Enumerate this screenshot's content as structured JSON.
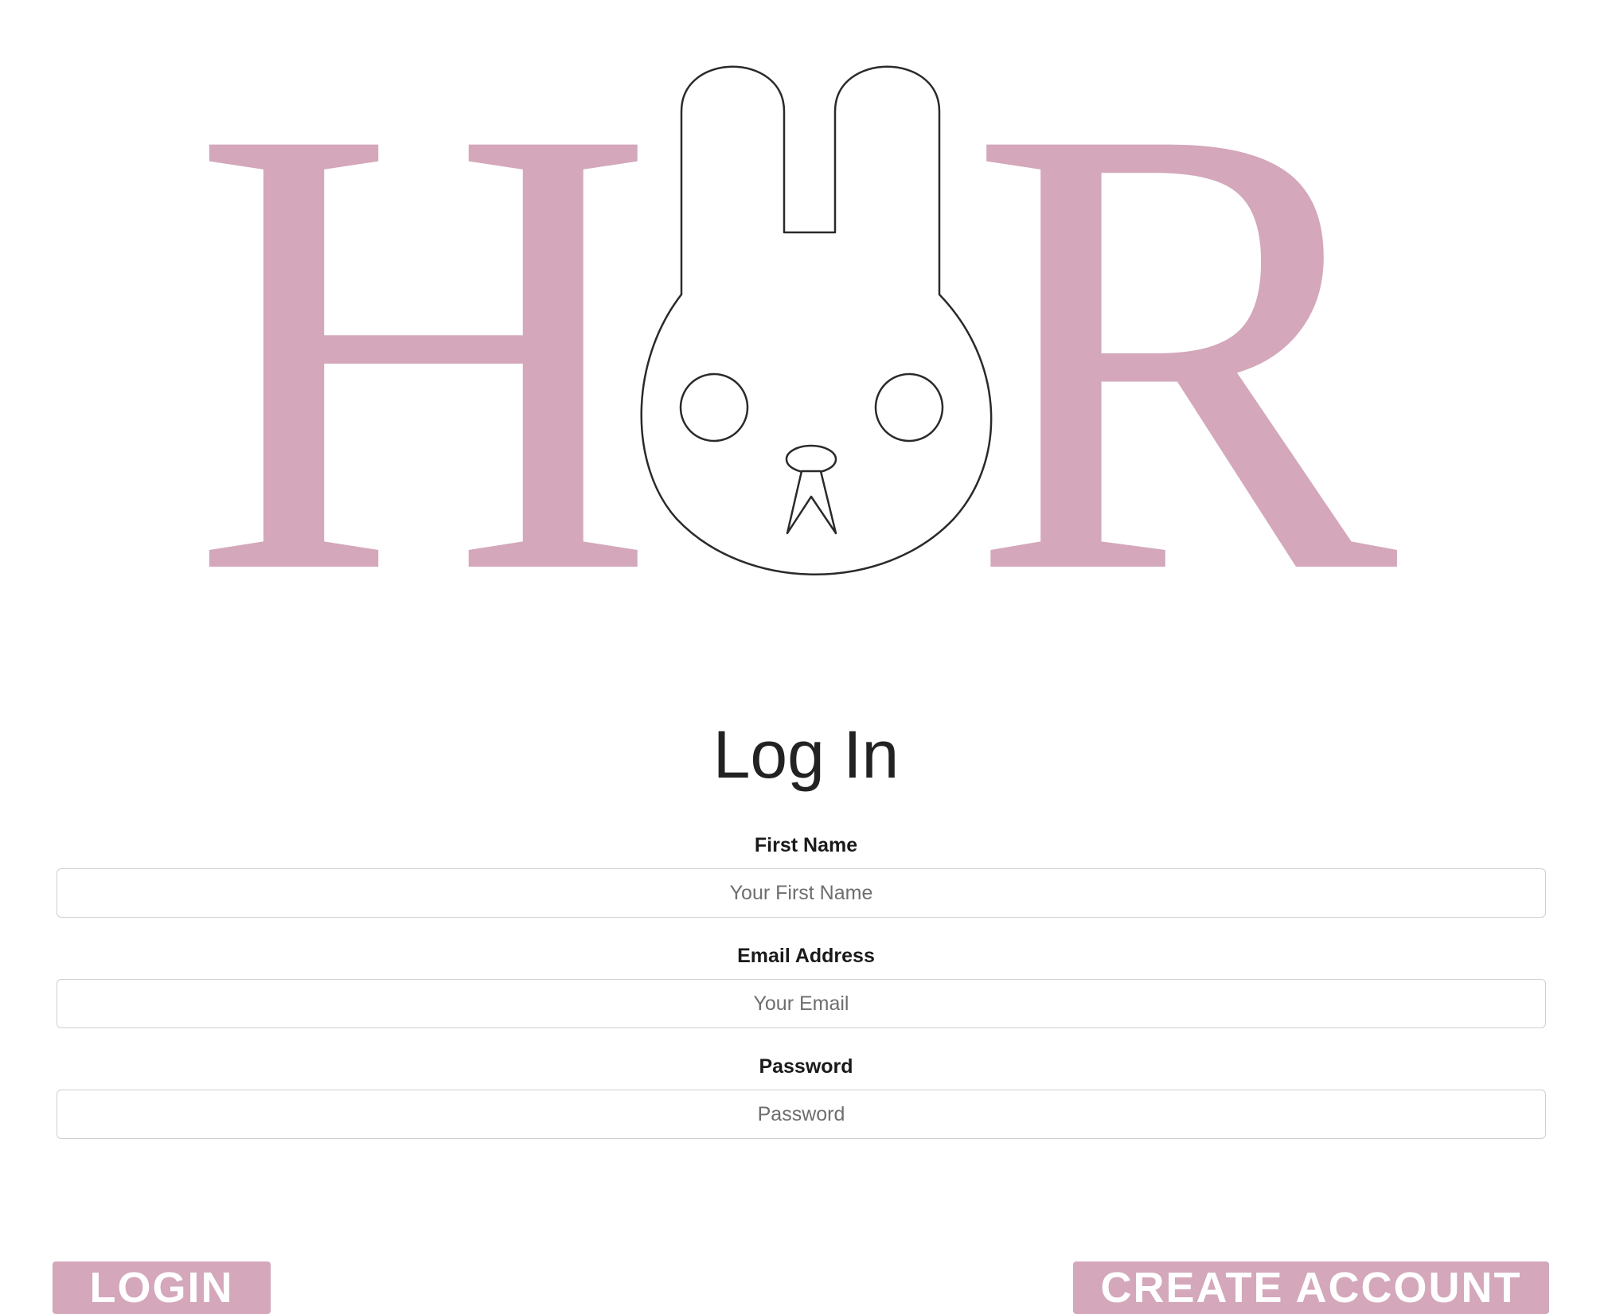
{
  "logo": {
    "letter_left": "H",
    "letter_right": "R",
    "mascot": "rabbit-head-icon",
    "brand_color": "#d4a7bb"
  },
  "form": {
    "title": "Log In",
    "fields": [
      {
        "label": "First Name",
        "placeholder": "Your First Name",
        "value": ""
      },
      {
        "label": "Email Address",
        "placeholder": "Your Email",
        "value": ""
      },
      {
        "label": "Password",
        "placeholder": "Password",
        "value": ""
      }
    ]
  },
  "buttons": {
    "login_label": "LOGIN",
    "create_account_label": "CREATE ACCOUNT"
  },
  "colors": {
    "accent": "#d4a7bb",
    "text": "#222222",
    "input_border": "#cfcfcf"
  }
}
